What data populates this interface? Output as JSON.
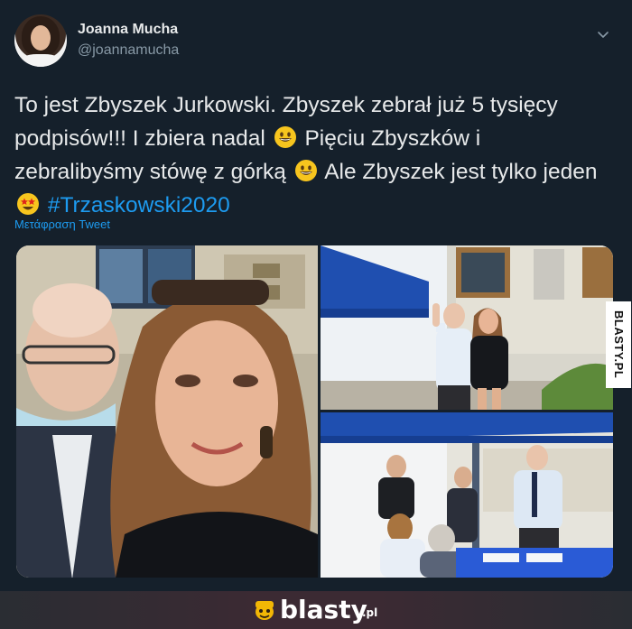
{
  "tweet": {
    "author_name": "Joanna Mucha",
    "author_handle": "@joannamucha",
    "text_part1": "To jest Zbyszek Jurkowski. Zbyszek zebrał już 5 tysięcy podpisów!!! I zbiera nadal",
    "text_part2": " Pięciu Zbyszków i zebralibyśmy stówę z górką",
    "text_part3": " Ale Zbyszek jest tylko jeden",
    "hashtag": "#Trzaskowski2020",
    "translate_label": "Μετάφραση Tweet",
    "emojis": [
      "grinning-face-emoji",
      "grinning-face-emoji",
      "star-struck-emoji"
    ]
  },
  "media": {
    "photos": [
      "selfie-photo",
      "campaign-tent-photo",
      "signature-table-photo"
    ]
  },
  "watermark": {
    "side_text": "BLASTY.PL",
    "footer_brand": "blasty",
    "footer_tld": ".pl"
  },
  "colors": {
    "background": "#15202b",
    "text": "#e7e9ea",
    "secondary_text": "#8899a6",
    "link": "#1d9bf0",
    "tent_blue": "#1f4fb0"
  }
}
